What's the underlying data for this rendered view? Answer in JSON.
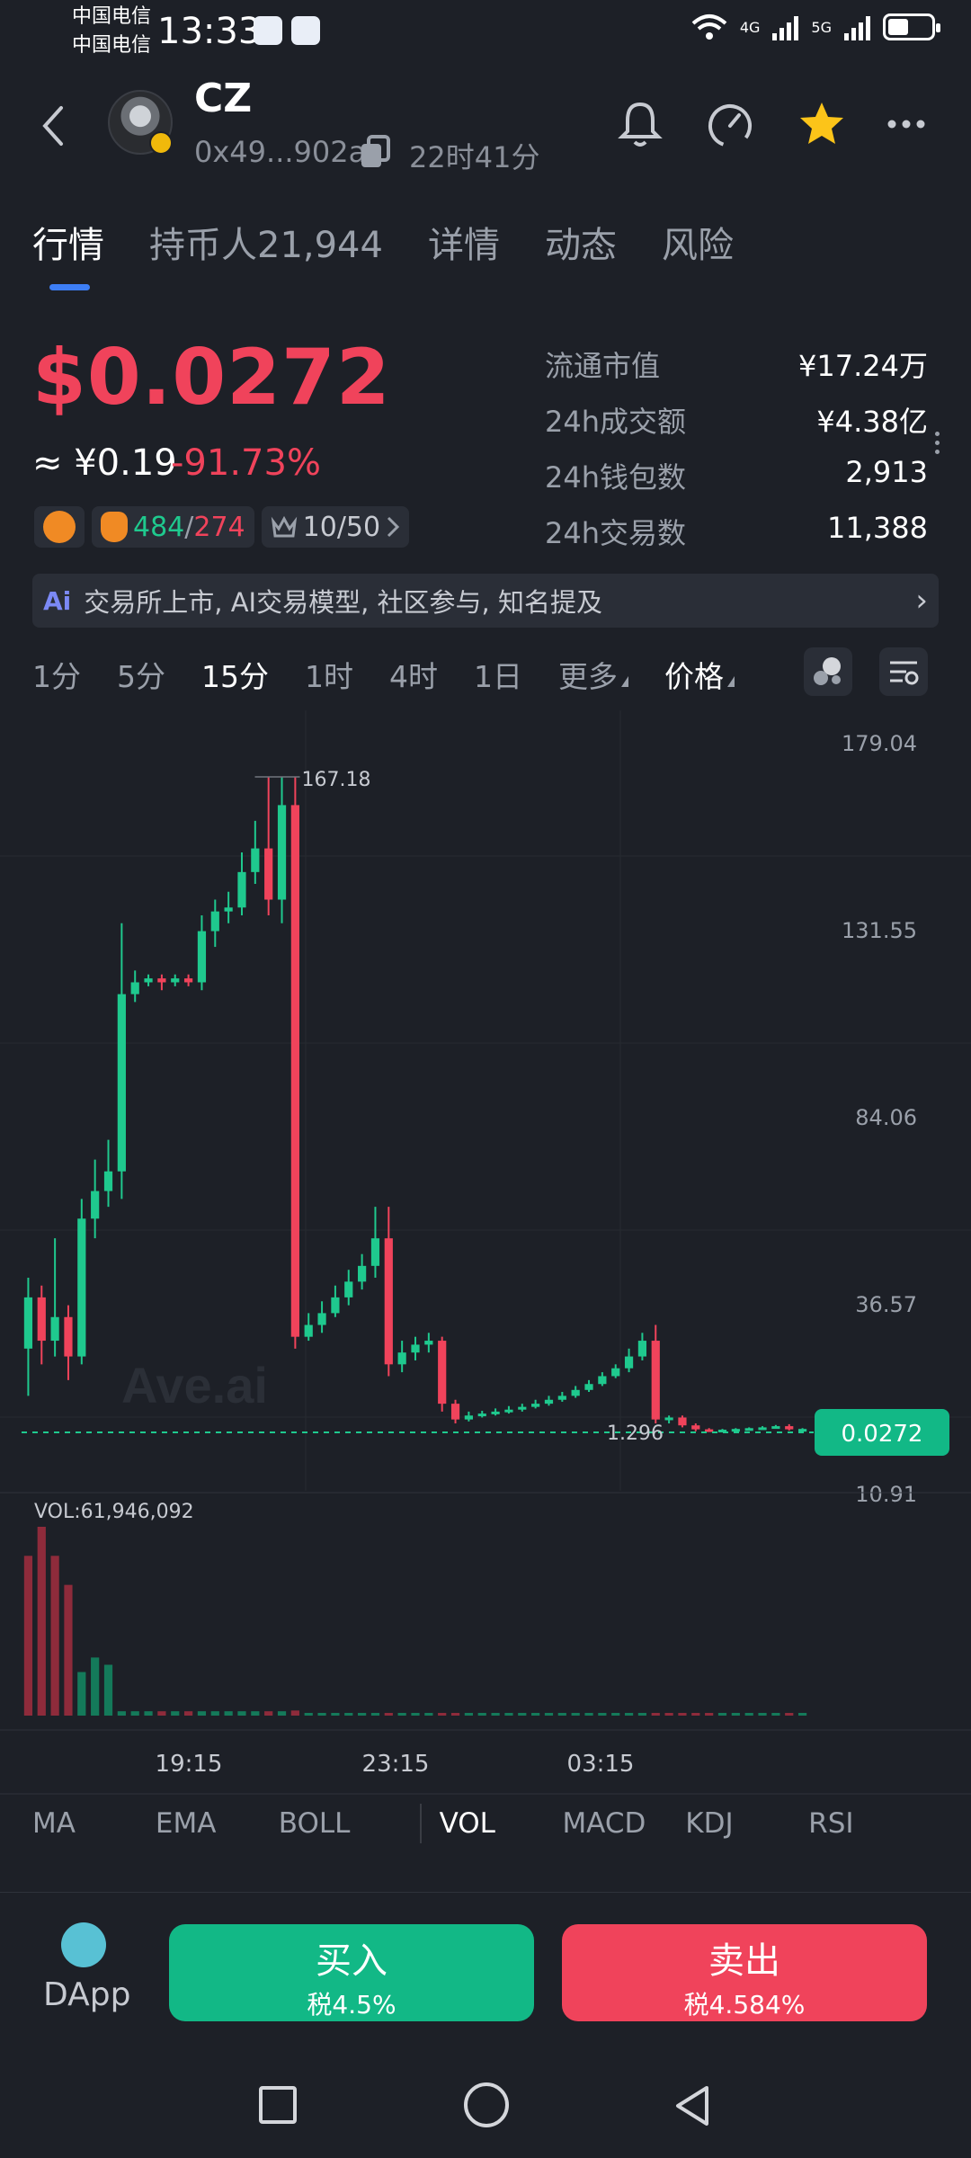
{
  "status_bar": {
    "carrier_1": "中国电信",
    "carrier_2": "中国电信",
    "time": "13:33",
    "net_1": "4G",
    "net_2": "5G"
  },
  "header": {
    "token_name": "CZ",
    "address": "0x49...902a",
    "age": "22时41分"
  },
  "tabs": [
    {
      "label": "行情",
      "active": true
    },
    {
      "label": "持币人21,944"
    },
    {
      "label": "详情"
    },
    {
      "label": "动态"
    },
    {
      "label": "风险"
    }
  ],
  "price": {
    "usd": "$0.0272",
    "cny": "≈ ¥0.19",
    "change": "-91.73%",
    "holders_buy": "484",
    "slash": "/",
    "holders_sell": "274",
    "rank": "10/50"
  },
  "stats": [
    {
      "label": "流通市值",
      "value": "¥17.24万"
    },
    {
      "label": "24h成交额",
      "value": "¥4.38亿"
    },
    {
      "label": "24h钱包数",
      "value": "2,913"
    },
    {
      "label": "24h交易数",
      "value": "11,388"
    }
  ],
  "ai_banner": {
    "icon_text": "Ai",
    "text": "交易所上市, AI交易模型, 社区参与, 知名提及"
  },
  "timeframes": [
    "1分",
    "5分",
    "15分",
    "1时",
    "4时",
    "1日",
    "更多"
  ],
  "timeframe_active": "15分",
  "price_mode": "价格",
  "chart_data": {
    "type": "candlestick",
    "watermark": "Ave.ai",
    "y_ticks": [
      "179.04",
      "131.55",
      "84.06",
      "36.57",
      "10.91"
    ],
    "y_tick_values": [
      179.04,
      131.55,
      84.06,
      36.57,
      10.91
    ],
    "ylim": [
      10.91,
      179.04
    ],
    "high_label": "167.18",
    "low_label": "1.296",
    "current_price_label": "0.0272",
    "x_ticks": [
      "19:15",
      "23:15",
      "03:15"
    ],
    "volume_label": "VOL:61,946,092",
    "candles": [
      {
        "o": 22,
        "c": 35,
        "h": 40,
        "l": 10
      },
      {
        "o": 35,
        "c": 24,
        "h": 38,
        "l": 18
      },
      {
        "o": 24,
        "c": 30,
        "h": 50,
        "l": 20
      },
      {
        "o": 30,
        "c": 20,
        "h": 33,
        "l": 14
      },
      {
        "o": 20,
        "c": 55,
        "h": 60,
        "l": 18
      },
      {
        "o": 55,
        "c": 62,
        "h": 70,
        "l": 50
      },
      {
        "o": 62,
        "c": 67,
        "h": 75,
        "l": 58
      },
      {
        "o": 67,
        "c": 112,
        "h": 130,
        "l": 60
      },
      {
        "o": 112,
        "c": 115,
        "h": 118,
        "l": 110
      },
      {
        "o": 115,
        "c": 116,
        "h": 117,
        "l": 114
      },
      {
        "o": 116,
        "c": 115,
        "h": 117,
        "l": 113
      },
      {
        "o": 115,
        "c": 116,
        "h": 117,
        "l": 114
      },
      {
        "o": 116,
        "c": 115,
        "h": 117,
        "l": 114
      },
      {
        "o": 115,
        "c": 128,
        "h": 132,
        "l": 113
      },
      {
        "o": 128,
        "c": 133,
        "h": 136,
        "l": 124
      },
      {
        "o": 133,
        "c": 134,
        "h": 138,
        "l": 130
      },
      {
        "o": 134,
        "c": 143,
        "h": 148,
        "l": 132
      },
      {
        "o": 143,
        "c": 149,
        "h": 156,
        "l": 140
      },
      {
        "o": 149,
        "c": 136,
        "h": 167,
        "l": 132
      },
      {
        "o": 136,
        "c": 160,
        "h": 167,
        "l": 130
      },
      {
        "o": 160,
        "c": 25,
        "h": 167,
        "l": 22
      },
      {
        "o": 25,
        "c": 28,
        "h": 31,
        "l": 24
      },
      {
        "o": 28,
        "c": 31,
        "h": 34,
        "l": 26
      },
      {
        "o": 31,
        "c": 35,
        "h": 38,
        "l": 30
      },
      {
        "o": 35,
        "c": 39,
        "h": 42,
        "l": 33
      },
      {
        "o": 39,
        "c": 43,
        "h": 46,
        "l": 37
      },
      {
        "o": 43,
        "c": 50,
        "h": 58,
        "l": 40
      },
      {
        "o": 50,
        "c": 18,
        "h": 58,
        "l": 15
      },
      {
        "o": 18,
        "c": 21,
        "h": 24,
        "l": 16
      },
      {
        "o": 21,
        "c": 23,
        "h": 25,
        "l": 19
      },
      {
        "o": 23,
        "c": 24,
        "h": 26,
        "l": 21
      },
      {
        "o": 24,
        "c": 8,
        "h": 25,
        "l": 6
      },
      {
        "o": 8,
        "c": 4,
        "h": 9,
        "l": 3
      },
      {
        "o": 4,
        "c": 5,
        "h": 6,
        "l": 3.5
      },
      {
        "o": 5,
        "c": 5.5,
        "h": 6.2,
        "l": 4.5
      },
      {
        "o": 5.5,
        "c": 6,
        "h": 6.8,
        "l": 5
      },
      {
        "o": 6,
        "c": 6.5,
        "h": 7.4,
        "l": 5.5
      },
      {
        "o": 6.5,
        "c": 7.2,
        "h": 8,
        "l": 6
      },
      {
        "o": 7.2,
        "c": 8,
        "h": 9,
        "l": 6.8
      },
      {
        "o": 8,
        "c": 9,
        "h": 10,
        "l": 7.5
      },
      {
        "o": 9,
        "c": 10,
        "h": 11,
        "l": 8.5
      },
      {
        "o": 10,
        "c": 11.5,
        "h": 12.5,
        "l": 9.5
      },
      {
        "o": 11.5,
        "c": 13,
        "h": 14,
        "l": 11
      },
      {
        "o": 13,
        "c": 15,
        "h": 16,
        "l": 12.5
      },
      {
        "o": 15,
        "c": 17,
        "h": 18,
        "l": 14.5
      },
      {
        "o": 17,
        "c": 20,
        "h": 22,
        "l": 16
      },
      {
        "o": 20,
        "c": 24,
        "h": 26,
        "l": 19
      },
      {
        "o": 24,
        "c": 4,
        "h": 28,
        "l": 3
      },
      {
        "o": 4,
        "c": 4.5,
        "h": 5,
        "l": 3
      },
      {
        "o": 4.5,
        "c": 2.5,
        "h": 5,
        "l": 2
      },
      {
        "o": 2.5,
        "c": 1.5,
        "h": 3,
        "l": 1
      },
      {
        "o": 1.5,
        "c": 1.3,
        "h": 1.8,
        "l": 1
      },
      {
        "o": 1.3,
        "c": 1.4,
        "h": 1.6,
        "l": 1.1
      },
      {
        "o": 1.4,
        "c": 1.6,
        "h": 1.8,
        "l": 1.2
      },
      {
        "o": 1.6,
        "c": 1.8,
        "h": 2,
        "l": 1.4
      },
      {
        "o": 1.8,
        "c": 2,
        "h": 2.3,
        "l": 1.6
      },
      {
        "o": 2,
        "c": 2.3,
        "h": 2.6,
        "l": 1.9
      },
      {
        "o": 2.3,
        "c": 1.5,
        "h": 2.8,
        "l": 1.2
      },
      {
        "o": 1.5,
        "c": 1.6,
        "h": 1.8,
        "l": 1.3
      }
    ],
    "volumes": [
      {
        "v": 22,
        "up": false
      },
      {
        "v": 26,
        "up": false
      },
      {
        "v": 22,
        "up": false
      },
      {
        "v": 18,
        "up": false
      },
      {
        "v": 6,
        "up": true
      },
      {
        "v": 8,
        "up": true
      },
      {
        "v": 7,
        "up": true
      },
      {
        "v": 0.6,
        "up": true
      },
      {
        "v": 0.6,
        "up": true
      },
      {
        "v": 0.6,
        "up": true
      },
      {
        "v": 0.6,
        "up": false
      },
      {
        "v": 0.6,
        "up": true
      },
      {
        "v": 0.6,
        "up": false
      },
      {
        "v": 0.6,
        "up": true
      },
      {
        "v": 0.6,
        "up": true
      },
      {
        "v": 0.6,
        "up": true
      },
      {
        "v": 0.6,
        "up": true
      },
      {
        "v": 0.6,
        "up": true
      },
      {
        "v": 0.6,
        "up": false
      },
      {
        "v": 0.6,
        "up": true
      },
      {
        "v": 0.7,
        "up": false
      },
      {
        "v": 0.2,
        "up": true
      },
      {
        "v": 0.2,
        "up": true
      },
      {
        "v": 0.2,
        "up": true
      },
      {
        "v": 0.2,
        "up": true
      },
      {
        "v": 0.2,
        "up": true
      },
      {
        "v": 0.2,
        "up": true
      },
      {
        "v": 0.3,
        "up": false
      },
      {
        "v": 0.2,
        "up": true
      },
      {
        "v": 0.2,
        "up": true
      },
      {
        "v": 0.2,
        "up": true
      },
      {
        "v": 0.3,
        "up": false
      },
      {
        "v": 0.3,
        "up": false
      },
      {
        "v": 0.1,
        "up": true
      },
      {
        "v": 0.1,
        "up": true
      },
      {
        "v": 0.1,
        "up": true
      },
      {
        "v": 0.1,
        "up": true
      },
      {
        "v": 0.1,
        "up": true
      },
      {
        "v": 0.1,
        "up": true
      },
      {
        "v": 0.1,
        "up": true
      },
      {
        "v": 0.1,
        "up": true
      },
      {
        "v": 0.1,
        "up": true
      },
      {
        "v": 0.1,
        "up": true
      },
      {
        "v": 0.1,
        "up": true
      },
      {
        "v": 0.1,
        "up": true
      },
      {
        "v": 0.1,
        "up": true
      },
      {
        "v": 0.1,
        "up": true
      },
      {
        "v": 0.3,
        "up": false
      },
      {
        "v": 0.2,
        "up": false
      },
      {
        "v": 0.2,
        "up": false
      },
      {
        "v": 0.2,
        "up": false
      },
      {
        "v": 0.1,
        "up": false
      },
      {
        "v": 0.1,
        "up": true
      },
      {
        "v": 0.1,
        "up": true
      },
      {
        "v": 0.1,
        "up": true
      },
      {
        "v": 0.1,
        "up": true
      },
      {
        "v": 0.1,
        "up": true
      },
      {
        "v": 0.1,
        "up": false
      },
      {
        "v": 0.1,
        "up": true
      }
    ],
    "colors": {
      "up": "#1fc98e",
      "down": "#f0435b"
    }
  },
  "indicators": [
    "MA",
    "EMA",
    "BOLL",
    "VOL",
    "MACD",
    "KDJ",
    "RSI"
  ],
  "indicator_active": "VOL",
  "bottom": {
    "dapp_label": "DApp",
    "buy_label": "买入",
    "buy_tax": "税4.5%",
    "sell_label": "卖出",
    "sell_tax": "税4.584%"
  }
}
